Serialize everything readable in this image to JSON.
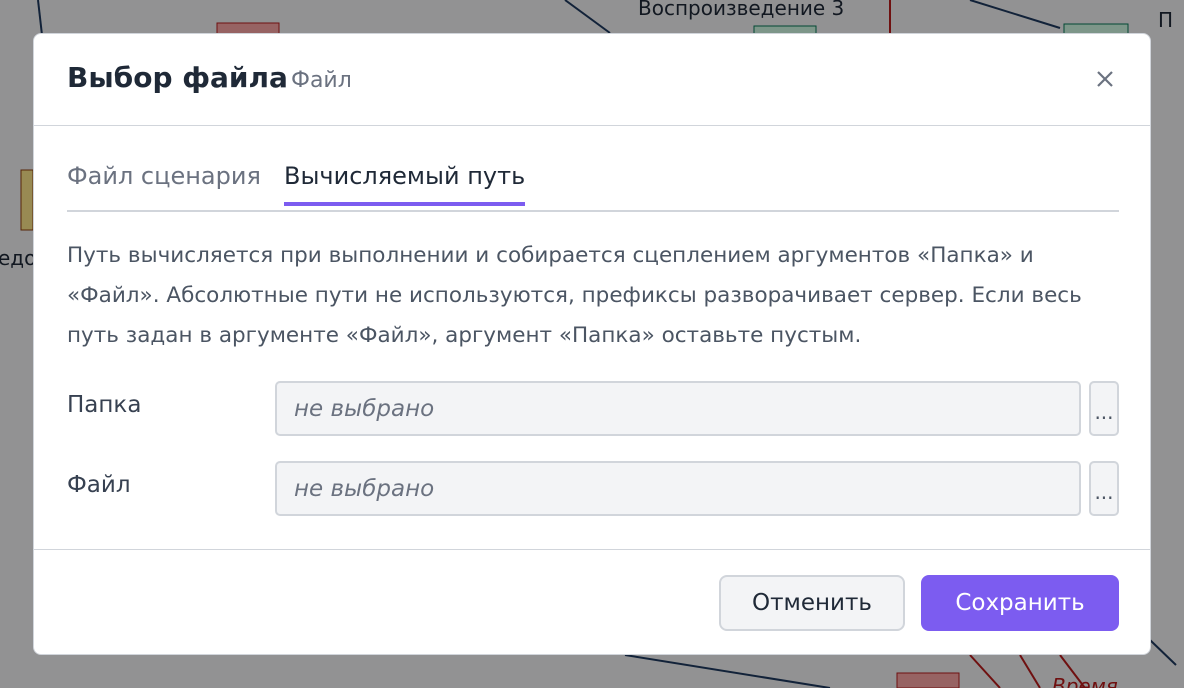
{
  "background": {
    "labels": {
      "top_center": "Воспроизведение 3",
      "top_right": "П",
      "left_cut": "едо",
      "bottom_right": "Время"
    }
  },
  "modal": {
    "title": "Выбор файла",
    "subtitle": "Файл",
    "close_icon": "×",
    "tabs": [
      {
        "label": "Файл сценария",
        "active": false
      },
      {
        "label": "Вычисляемый путь",
        "active": true
      }
    ],
    "description": "Путь вычисляется при выполнении и собирается сцеплением аргументов «Папка» и «Файл». Абсолютные пути не используются, префиксы разворачивает сервер. Если весь путь задан в аргументе «Файл», аргумент «Папка» оставьте пустым.",
    "fields": [
      {
        "label": "Папка",
        "placeholder": "не выбрано",
        "value": "",
        "browse_label": "..."
      },
      {
        "label": "Файл",
        "placeholder": "не выбрано",
        "value": "",
        "browse_label": "..."
      }
    ],
    "footer": {
      "cancel_label": "Отменить",
      "save_label": "Сохранить"
    }
  },
  "colors": {
    "accent": "#7c5cf0",
    "overlay": "rgba(0,0,0,0.40)"
  }
}
